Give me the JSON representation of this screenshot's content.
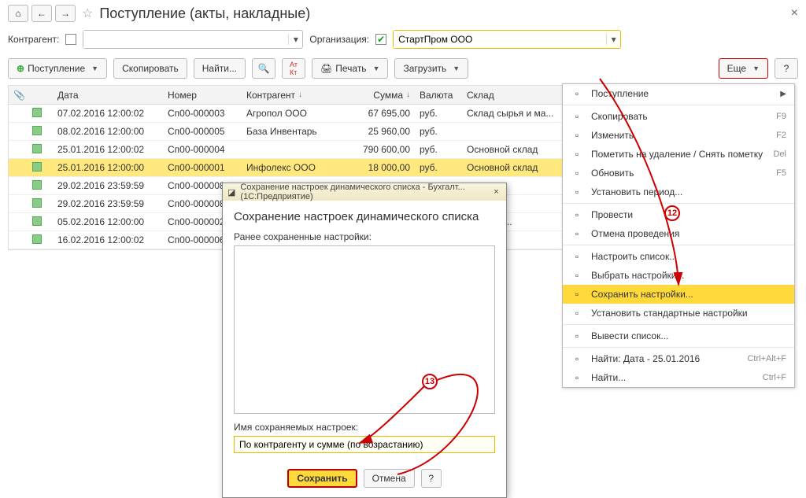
{
  "header": {
    "title": "Поступление (акты, накладные)"
  },
  "filters": {
    "counterparty_label": "Контрагент:",
    "org_label": "Организация:",
    "org_value": "СтартПром ООО"
  },
  "toolbar": {
    "postuplenie": "Поступление",
    "copy": "Скопировать",
    "find": "Найти...",
    "print": "Печать",
    "load": "Загрузить",
    "more": "Еще",
    "help": "?"
  },
  "columns": {
    "date": "Дата",
    "number": "Номер",
    "counterparty": "Контрагент",
    "sum": "Сумма",
    "currency": "Валюта",
    "warehouse": "Склад"
  },
  "rows": [
    {
      "date": "07.02.2016 12:00:02",
      "num": "Сп00-000003",
      "cp": "Агропол ООО",
      "sum": "67 695,00",
      "cur": "руб.",
      "wh": "Склад сырья и ма..."
    },
    {
      "date": "08.02.2016 12:00:00",
      "num": "Сп00-000005",
      "cp": "База Инвентарь",
      "sum": "25 960,00",
      "cur": "руб.",
      "wh": ""
    },
    {
      "date": "25.01.2016 12:00:02",
      "num": "Сп00-000004",
      "cp": "",
      "sum": "790 600,00",
      "cur": "руб.",
      "wh": "Основной склад"
    },
    {
      "date": "25.01.2016 12:00:00",
      "num": "Сп00-000001",
      "cp": "Инфолекс ООО",
      "sum": "18 000,00",
      "cur": "руб.",
      "wh": "Основной склад",
      "sel": true
    },
    {
      "date": "29.02.2016 23:59:59",
      "num": "Сп00-000008",
      "cp": "",
      "sum": "",
      "cur": "",
      "wh": ""
    },
    {
      "date": "29.02.2016 23:59:59",
      "num": "Сп00-000008",
      "cp": "",
      "sum": "",
      "cur": "",
      "wh": ""
    },
    {
      "date": "05.02.2016 12:00:00",
      "num": "Сп00-000002",
      "cp": "",
      "sum": "",
      "cur": "",
      "wh": "рья и ма..."
    },
    {
      "date": "16.02.2016 12:00:02",
      "num": "Сп00-000006",
      "cp": "",
      "sum": "",
      "cur": "",
      "wh": "склад"
    }
  ],
  "menu": {
    "items": [
      {
        "label": "Поступление",
        "arrow": true
      },
      {
        "label": "Скопировать",
        "sc": "F9"
      },
      {
        "label": "Изменить",
        "sc": "F2"
      },
      {
        "label": "Пометить на удаление / Снять пометку",
        "sc": "Del"
      },
      {
        "label": "Обновить",
        "sc": "F5"
      },
      {
        "label": "Установить период..."
      },
      {
        "label": "Провести"
      },
      {
        "label": "Отмена проведения"
      },
      {
        "label": "Настроить список..."
      },
      {
        "label": "Выбрать настройки..."
      },
      {
        "label": "Сохранить настройки...",
        "hl": true
      },
      {
        "label": "Установить стандартные настройки"
      },
      {
        "label": "Вывести список..."
      },
      {
        "label": "Найти: Дата - 25.01.2016",
        "sc": "Ctrl+Alt+F"
      },
      {
        "label": "Найти...",
        "sc": "Ctrl+F"
      }
    ]
  },
  "dialog": {
    "wintitle": "Сохранение настроек динамического списка - Бухгалт...   (1С:Предприятие)",
    "title": "Сохранение настроек динамического списка",
    "prev_label": "Ранее сохраненные настройки:",
    "name_label": "Имя сохраняемых настроек:",
    "name_value": "По контрагенту и сумме (по возрастанию)",
    "save": "Сохранить",
    "cancel": "Отмена",
    "help": "?"
  },
  "annotations": {
    "n12": "12",
    "n13": "13"
  }
}
